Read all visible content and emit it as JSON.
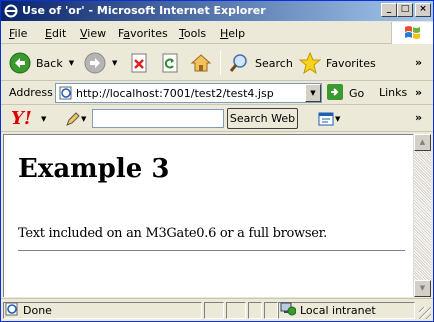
{
  "window": {
    "title": "Use of 'or' - Microsoft Internet Explorer"
  },
  "menu": [
    {
      "pre": "",
      "u": "F",
      "post": "ile"
    },
    {
      "pre": "",
      "u": "E",
      "post": "dit"
    },
    {
      "pre": "",
      "u": "V",
      "post": "iew"
    },
    {
      "pre": "F",
      "u": "a",
      "post": "vorites"
    },
    {
      "pre": "",
      "u": "T",
      "post": "ools"
    },
    {
      "pre": "",
      "u": "H",
      "post": "elp"
    }
  ],
  "toolbar": {
    "back_label": "Back",
    "search_label": "Search",
    "favorites_label": "Favorites"
  },
  "address": {
    "label": "Address",
    "url": "http://localhost:7001/test2/test4.jsp",
    "go_label": "Go",
    "links_label": "Links"
  },
  "yahoo": {
    "logo": "Y!",
    "search_button": "Search Web",
    "query": ""
  },
  "page": {
    "heading": "Example 3",
    "text": "Text included on an M3Gate0.6 or a full browser."
  },
  "status": {
    "text": "Done",
    "zone": "Local intranet"
  },
  "colors": {
    "titlebar": "#0a246a",
    "chrome": "#ece9d8",
    "link_blue": "#0000ff"
  }
}
